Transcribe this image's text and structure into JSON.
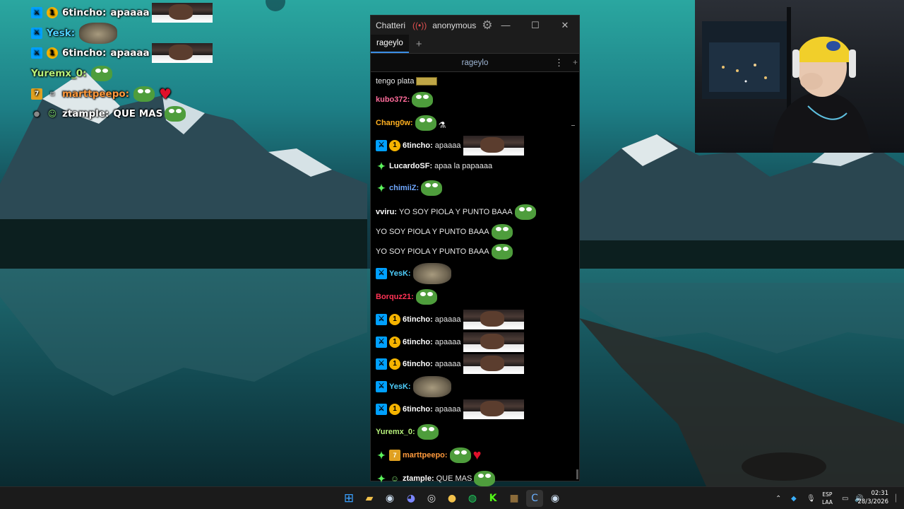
{
  "window": {
    "app_name": "Chatteri",
    "user": "anonymous",
    "tab": "rageylo",
    "split_channel": "rageylo"
  },
  "overlay": [
    {
      "badges": [
        "mod",
        "sub"
      ],
      "name": "6tincho",
      "name_color": "#ffffff",
      "text": "apaaaa",
      "emotes": [
        "face"
      ]
    },
    {
      "badges": [
        "mod"
      ],
      "name": "Yesk",
      "name_color": "#4fd0ff",
      "text": "",
      "emotes": [
        "cat"
      ]
    },
    {
      "badges": [
        "mod",
        "sub"
      ],
      "name": "6tincho",
      "name_color": "#ffffff",
      "text": "apaaaa",
      "emotes": [
        "face"
      ]
    },
    {
      "badges": [],
      "name": "Yuremx_0",
      "name_color": "#b6f07a",
      "text": "",
      "emotes": [
        "pepe"
      ]
    },
    {
      "badges": [
        "bits",
        "gift"
      ],
      "name": "marttpeepo",
      "name_color": "#ff9a3c",
      "text": "",
      "emotes": [
        "pepe",
        "heart"
      ]
    },
    {
      "badges": [
        "grey",
        "bot"
      ],
      "name": "ztample",
      "name_color": "#ffffff",
      "text": "QUE MAS",
      "emotes": [
        "pepe"
      ]
    }
  ],
  "messages": [
    {
      "badges": [],
      "name": "",
      "name_color": "#e6e6e6",
      "text": "tengo plata",
      "emotes": [
        "gold"
      ]
    },
    {
      "badges": [],
      "name": "kubo372",
      "name_color": "#ff6b9a",
      "text": "",
      "emotes": [
        "pepe"
      ]
    },
    {
      "badges": [],
      "name": "Chang0w",
      "name_color": "#ffb020",
      "text": "",
      "emotes": [
        "pepe",
        "vial"
      ]
    },
    {
      "badges": [
        "mod",
        "sub"
      ],
      "name": "6tincho",
      "name_color": "#ffffff",
      "text": "apaaaa",
      "emotes": [
        "face"
      ]
    },
    {
      "badges": [
        "star"
      ],
      "name": "LucardoSF",
      "name_color": "#ffffff",
      "text": "apaa la papaaaa",
      "emotes": []
    },
    {
      "badges": [
        "star"
      ],
      "name": "chimiiZ",
      "name_color": "#6fa8ff",
      "text": "",
      "emotes": [
        "pepe"
      ]
    },
    {
      "badges": [],
      "name": "vviru",
      "name_color": "#ffffff",
      "text": "YO SOY PIOLA Y PUNTO BAAA",
      "emotes": [
        "pepe"
      ],
      "continuation": [
        "YO SOY PIOLA Y PUNTO BAAA",
        "YO SOY PIOLA Y PUNTO BAAA"
      ]
    },
    {
      "badges": [
        "mod"
      ],
      "name": "YesK",
      "name_color": "#4fd0ff",
      "text": "",
      "emotes": [
        "cat"
      ]
    },
    {
      "badges": [],
      "name": "Borquz21",
      "name_color": "#ff3355",
      "text": "",
      "emotes": [
        "pepe"
      ]
    },
    {
      "badges": [
        "mod",
        "sub"
      ],
      "name": "6tincho",
      "name_color": "#ffffff",
      "text": "apaaaa",
      "emotes": [
        "face"
      ]
    },
    {
      "badges": [
        "mod",
        "sub"
      ],
      "name": "6tincho",
      "name_color": "#ffffff",
      "text": "apaaaa",
      "emotes": [
        "face"
      ]
    },
    {
      "badges": [
        "mod",
        "sub"
      ],
      "name": "6tincho",
      "name_color": "#ffffff",
      "text": "apaaaa",
      "emotes": [
        "face"
      ]
    },
    {
      "badges": [
        "mod"
      ],
      "name": "YesK",
      "name_color": "#4fd0ff",
      "text": "",
      "emotes": [
        "cat"
      ]
    },
    {
      "badges": [
        "mod",
        "sub"
      ],
      "name": "6tincho",
      "name_color": "#ffffff",
      "text": "apaaaa",
      "emotes": [
        "face"
      ]
    },
    {
      "badges": [],
      "name": "Yuremx_0",
      "name_color": "#b6f07a",
      "text": "",
      "emotes": [
        "pepe"
      ]
    },
    {
      "badges": [
        "star",
        "bits"
      ],
      "name": "marttpeepo",
      "name_color": "#ff9a3c",
      "text": "",
      "emotes": [
        "pepe",
        "heart"
      ]
    },
    {
      "badges": [
        "star",
        "bot"
      ],
      "name": "ztample",
      "name_color": "#ffffff",
      "text": "QUE MAS",
      "emotes": [
        "pepe"
      ]
    }
  ],
  "taskbar": {
    "apps": [
      "windows-start",
      "file-explorer",
      "steam",
      "discord",
      "obs",
      "chrome",
      "spotify",
      "kick",
      "minecraft",
      "chatterino",
      "steam-alt"
    ],
    "lang_top": "ESP",
    "lang_bottom": "LAA",
    "time": "02:31",
    "date": "28/3/2026"
  },
  "colors": {
    "mod_badge": "#00a0ff",
    "sub_badge": "#f5b300",
    "tab_accent": "#3a8ee6"
  }
}
